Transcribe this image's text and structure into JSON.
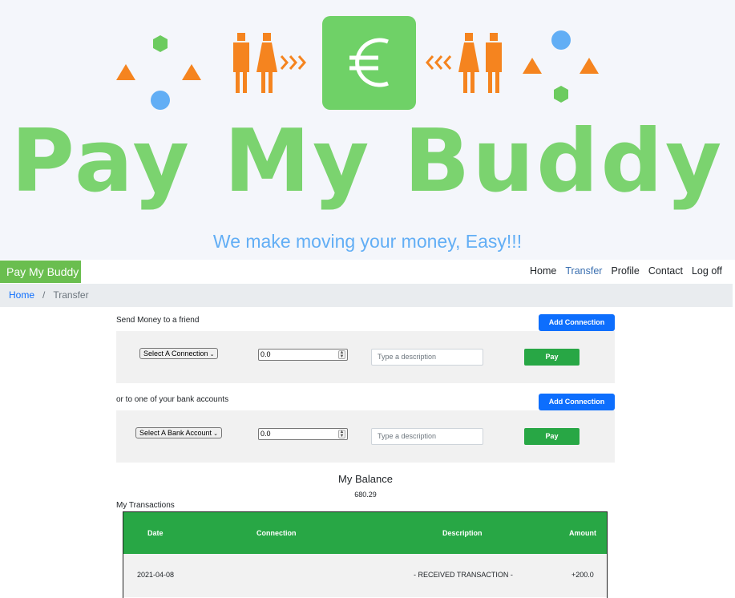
{
  "banner": {
    "logo_text": "Pay My Buddy",
    "tagline": "We make moving your money, Easy!!!",
    "emblem_icon": "euro-icon",
    "colors": {
      "green": "#7bd36f",
      "orange": "#f5841f",
      "blue": "#62aef5",
      "background": "#f4f6fb"
    }
  },
  "navbar": {
    "brand": "Pay My Buddy",
    "links": [
      "Home",
      "Transfer",
      "Profile",
      "Contact",
      "Log off"
    ],
    "active": "Transfer"
  },
  "breadcrumb": {
    "home": "Home",
    "separator": "/",
    "current": "Transfer"
  },
  "friend_transfer": {
    "title": "Send Money to a friend",
    "add_button": "Add Connection",
    "select_value": "Select A Connection",
    "amount": "0.0",
    "description_placeholder": "Type a description",
    "pay_button": "Pay"
  },
  "bank_transfer": {
    "title": "or to one of your bank accounts",
    "add_button": "Add Connection",
    "select_value": "Select A Bank Account",
    "amount": "0.0",
    "description_placeholder": "Type a description",
    "pay_button": "Pay"
  },
  "balance": {
    "title": "My Balance",
    "value": "680.29"
  },
  "transactions": {
    "title": "My Transactions",
    "headers": [
      "Date",
      "Connection",
      "Description",
      "Amount"
    ],
    "rows": [
      {
        "date": "2021-04-08",
        "connection": "",
        "description": "- RECEIVED TRANSACTION -",
        "amount": "+200.0"
      }
    ],
    "header_color": "#28a745"
  }
}
